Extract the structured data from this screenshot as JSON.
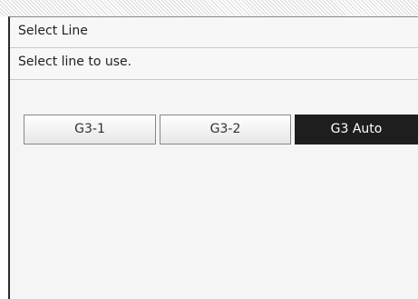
{
  "dialog": {
    "title": "Select Line",
    "message": "Select line to use."
  },
  "lines": [
    {
      "label": "G3-1",
      "selected": false
    },
    {
      "label": "G3-2",
      "selected": false
    },
    {
      "label": "G3 Auto",
      "selected": true
    }
  ],
  "colors": {
    "selected_bg": "#1e1e1e",
    "selected_fg": "#ffffff",
    "button_bg": "#f2f2f2",
    "panel_bg": "#f5f5f5"
  }
}
